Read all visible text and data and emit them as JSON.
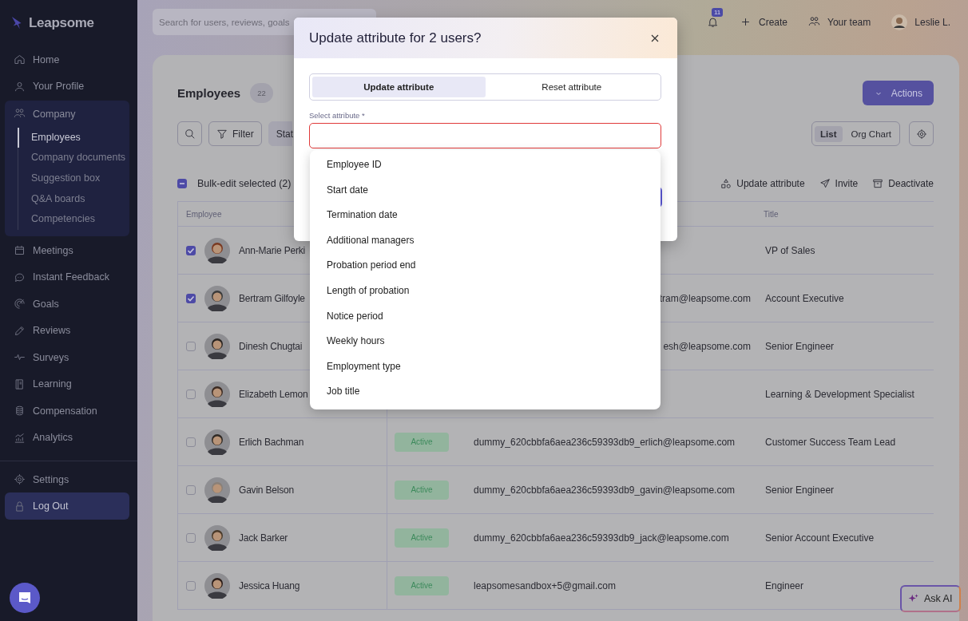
{
  "sidebar": {
    "logo": "Leapsome",
    "items": [
      {
        "label": "Home",
        "selected": false
      },
      {
        "label": "Your Profile",
        "selected": false
      },
      {
        "label": "Company",
        "selected": false,
        "expanded": true,
        "children": [
          {
            "label": "Employees",
            "selected": true
          },
          {
            "label": "Company documents",
            "selected": false
          },
          {
            "label": "Suggestion box",
            "selected": false
          },
          {
            "label": "Q&A boards",
            "selected": false
          },
          {
            "label": "Competencies",
            "selected": false
          }
        ]
      },
      {
        "label": "Meetings",
        "selected": false
      },
      {
        "label": "Instant Feedback",
        "selected": false
      },
      {
        "label": "Goals",
        "selected": false
      },
      {
        "label": "Reviews",
        "selected": false
      },
      {
        "label": "Surveys",
        "selected": false
      },
      {
        "label": "Learning",
        "selected": false
      },
      {
        "label": "Compensation",
        "selected": false
      },
      {
        "label": "Analytics",
        "selected": false
      }
    ],
    "bottom_items": [
      {
        "label": "Settings",
        "selected": false
      },
      {
        "label": "Log Out",
        "selected": true
      }
    ]
  },
  "topbar": {
    "search": {
      "placeholder": "Search for users, reviews, goals"
    },
    "notifications": "11",
    "create": "Create",
    "team": "Your team",
    "user": "Leslie L."
  },
  "page": {
    "title": "Employees",
    "count": "22",
    "actions": "Actions",
    "filter": "Filter",
    "status_filter": "Stat",
    "views": [
      {
        "label": "List",
        "selected": true
      },
      {
        "label": "Org Chart",
        "selected": false
      }
    ],
    "bulk": {
      "label": "Bulk-edit selected (2)",
      "indeterminate": true
    },
    "bulk_actions": [
      "Update attribute",
      "Invite",
      "Deactivate"
    ]
  },
  "table": {
    "columns": [
      "Employee",
      "Title"
    ],
    "rows": [
      {
        "name": "Ann-Marie Perki",
        "checked": true,
        "title": "VP of Sales"
      },
      {
        "name": "Bertram Gilfoyle",
        "checked": true,
        "email": "tram@leapsome.com",
        "title": "Account Executive"
      },
      {
        "name": "Dinesh Chugtai",
        "checked": false,
        "email": "esh@leapsome.com",
        "title": "Senior Engineer"
      },
      {
        "name": "Elizabeth Lemon",
        "checked": false,
        "title": "Learning & Development Specialist"
      },
      {
        "name": "Erlich Bachman",
        "checked": false,
        "status": "Active",
        "email": "dummy_620cbbfa6aea236c59393db9_erlich@leapsome.com",
        "title": "Customer Success Team Lead"
      },
      {
        "name": "Gavin Belson",
        "checked": false,
        "status": "Active",
        "email": "dummy_620cbbfa6aea236c59393db9_gavin@leapsome.com",
        "title": "Senior Engineer"
      },
      {
        "name": "Jack Barker",
        "checked": false,
        "status": "Active",
        "email": "dummy_620cbbfa6aea236c59393db9_jack@leapsome.com",
        "title": "Senior Account Executive"
      },
      {
        "name": "Jessica Huang",
        "checked": false,
        "status": "Active",
        "email": "leapsomesandbox+5@gmail.com",
        "title": "Engineer"
      }
    ]
  },
  "modal": {
    "title": "Update attribute for 2 users?",
    "tabs": [
      {
        "label": "Update attribute",
        "selected": true
      },
      {
        "label": "Reset attribute",
        "selected": false
      }
    ],
    "field": {
      "label": "Select attribute *",
      "error": true
    },
    "options": [
      "Employee ID",
      "Start date",
      "Termination date",
      "Additional managers",
      "Probation period end",
      "Length of probation",
      "Notice period",
      "Weekly hours",
      "Employment type",
      "Job title"
    ]
  },
  "ask_ai": "Ask AI"
}
